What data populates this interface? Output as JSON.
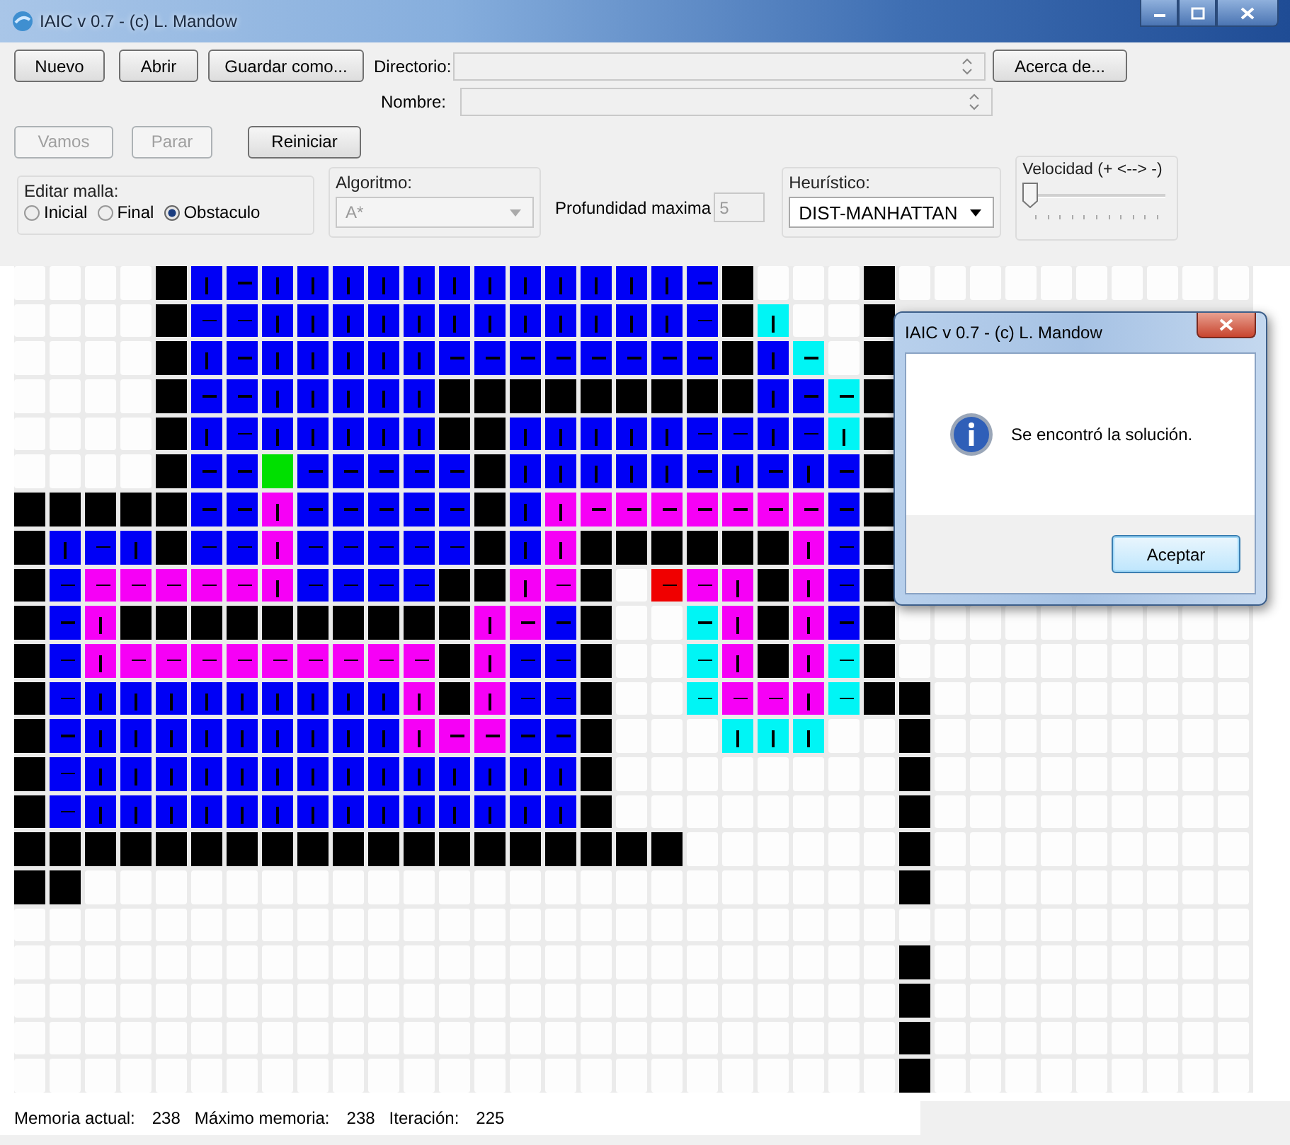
{
  "window": {
    "title": "IAIC v 0.7 - (c) L. Mandow"
  },
  "file_buttons": [
    {
      "label": "Nuevo"
    },
    {
      "label": "Abrir"
    },
    {
      "label": "Guardar como..."
    }
  ],
  "directory": {
    "label": "Directorio:"
  },
  "name": {
    "label": "Nombre:"
  },
  "about_button": {
    "label": "Acerca de..."
  },
  "run_buttons": [
    {
      "label": "Vamos",
      "disabled": true
    },
    {
      "label": "Parar",
      "disabled": true
    },
    {
      "label": "Reiniciar",
      "disabled": false
    }
  ],
  "edit_mode": {
    "label": "Editar malla:",
    "options": [
      {
        "label": "Inicial",
        "selected": false
      },
      {
        "label": "Final",
        "selected": false
      },
      {
        "label": "Obstaculo",
        "selected": true
      }
    ]
  },
  "algorithm": {
    "label": "Algoritmo:",
    "value": "A*",
    "disabled": true
  },
  "max_depth": {
    "label": "Profundidad maxima",
    "value": "5",
    "disabled": true
  },
  "heuristic": {
    "label": "Heurístico:",
    "value": "DIST-MANHATTAN"
  },
  "speed": {
    "label": "Velocidad (+ <--> -)",
    "level": 0
  },
  "grid": {
    "rows": [
      [
        {
          "kind": "E"
        },
        {
          "kind": "E"
        },
        {
          "kind": "E"
        },
        {
          "kind": "E"
        },
        {
          "kind": "W"
        },
        {
          "kind": "Bv"
        },
        {
          "kind": "Bh"
        },
        {
          "kind": "Bv"
        },
        {
          "kind": "Bv"
        },
        {
          "kind": "Bv"
        },
        {
          "kind": "Bv"
        },
        {
          "kind": "Bv"
        },
        {
          "kind": "Bv"
        },
        {
          "kind": "Bv"
        },
        {
          "kind": "Bv"
        },
        {
          "kind": "Bv"
        },
        {
          "kind": "Bv"
        },
        {
          "kind": "Bv"
        },
        {
          "kind": "Bv"
        },
        {
          "kind": "Bh"
        },
        {
          "kind": "W"
        },
        {
          "kind": "E"
        },
        {
          "kind": "E"
        },
        {
          "kind": "E"
        },
        {
          "kind": "W"
        },
        {
          "kind": "E"
        },
        {
          "kind": "E"
        },
        {
          "kind": "E"
        },
        {
          "kind": "E"
        },
        {
          "kind": "E"
        },
        {
          "kind": "E"
        },
        {
          "kind": "E"
        },
        {
          "kind": "E"
        },
        {
          "kind": "E"
        },
        {
          "kind": "E"
        }
      ],
      [
        {
          "kind": "E"
        },
        {
          "kind": "E"
        },
        {
          "kind": "E"
        },
        {
          "kind": "E"
        },
        {
          "kind": "W"
        },
        {
          "kind": "Bh"
        },
        {
          "kind": "Bh"
        },
        {
          "kind": "Bv"
        },
        {
          "kind": "Bv"
        },
        {
          "kind": "Bv"
        },
        {
          "kind": "Bv"
        },
        {
          "kind": "Bv"
        },
        {
          "kind": "Bv"
        },
        {
          "kind": "Bv"
        },
        {
          "kind": "Bv"
        },
        {
          "kind": "Bv"
        },
        {
          "kind": "Bv"
        },
        {
          "kind": "Bv"
        },
        {
          "kind": "Bv"
        },
        {
          "kind": "Bh"
        },
        {
          "kind": "W"
        },
        {
          "kind": "Cv"
        },
        {
          "kind": "E"
        },
        {
          "kind": "E"
        },
        {
          "kind": "W"
        }
      ],
      [
        {
          "kind": "E"
        },
        {
          "kind": "E"
        },
        {
          "kind": "E"
        },
        {
          "kind": "E"
        },
        {
          "kind": "W"
        },
        {
          "kind": "Bv"
        },
        {
          "kind": "Bh"
        },
        {
          "kind": "Bv"
        },
        {
          "kind": "Bv"
        },
        {
          "kind": "Bv"
        },
        {
          "kind": "Bv"
        },
        {
          "kind": "Bv"
        },
        {
          "kind": "Bh"
        },
        {
          "kind": "Bh"
        },
        {
          "kind": "Bh"
        },
        {
          "kind": "Bh"
        },
        {
          "kind": "Bh"
        },
        {
          "kind": "Bh"
        },
        {
          "kind": "Bh"
        },
        {
          "kind": "Bh"
        },
        {
          "kind": "W"
        },
        {
          "kind": "Bv"
        },
        {
          "kind": "Ch"
        },
        {
          "kind": "E"
        },
        {
          "kind": "W"
        }
      ],
      [
        {
          "kind": "E"
        },
        {
          "kind": "E"
        },
        {
          "kind": "E"
        },
        {
          "kind": "E"
        },
        {
          "kind": "W"
        },
        {
          "kind": "Bh"
        },
        {
          "kind": "Bh"
        },
        {
          "kind": "Bv"
        },
        {
          "kind": "Bv"
        },
        {
          "kind": "Bv"
        },
        {
          "kind": "Bv"
        },
        {
          "kind": "Bv"
        },
        {
          "kind": "W"
        },
        {
          "kind": "W"
        },
        {
          "kind": "W"
        },
        {
          "kind": "W"
        },
        {
          "kind": "W"
        },
        {
          "kind": "W"
        },
        {
          "kind": "W"
        },
        {
          "kind": "W"
        },
        {
          "kind": "W"
        },
        {
          "kind": "Bv"
        },
        {
          "kind": "Bh"
        },
        {
          "kind": "Ch"
        },
        {
          "kind": "W"
        }
      ],
      [
        {
          "kind": "E"
        },
        {
          "kind": "E"
        },
        {
          "kind": "E"
        },
        {
          "kind": "E"
        },
        {
          "kind": "W"
        },
        {
          "kind": "Bv"
        },
        {
          "kind": "Bh"
        },
        {
          "kind": "Bv"
        },
        {
          "kind": "Bv"
        },
        {
          "kind": "Bv"
        },
        {
          "kind": "Bv"
        },
        {
          "kind": "Bv"
        },
        {
          "kind": "W"
        },
        {
          "kind": "W"
        },
        {
          "kind": "Bv"
        },
        {
          "kind": "Bv"
        },
        {
          "kind": "Bv"
        },
        {
          "kind": "Bv"
        },
        {
          "kind": "Bv"
        },
        {
          "kind": "Bh"
        },
        {
          "kind": "Bh"
        },
        {
          "kind": "Bv"
        },
        {
          "kind": "Bh"
        },
        {
          "kind": "Cv"
        },
        {
          "kind": "W"
        }
      ],
      [
        {
          "kind": "E"
        },
        {
          "kind": "E"
        },
        {
          "kind": "E"
        },
        {
          "kind": "E"
        },
        {
          "kind": "W"
        },
        {
          "kind": "Bh"
        },
        {
          "kind": "Bh"
        },
        {
          "kind": "S"
        },
        {
          "kind": "Bh"
        },
        {
          "kind": "Bh"
        },
        {
          "kind": "Bh"
        },
        {
          "kind": "Bh"
        },
        {
          "kind": "Bh"
        },
        {
          "kind": "W"
        },
        {
          "kind": "Bv"
        },
        {
          "kind": "Bv"
        },
        {
          "kind": "Bv"
        },
        {
          "kind": "Bv"
        },
        {
          "kind": "Bv"
        },
        {
          "kind": "Bh"
        },
        {
          "kind": "Bv"
        },
        {
          "kind": "Bh"
        },
        {
          "kind": "Bv"
        },
        {
          "kind": "Bh"
        },
        {
          "kind": "W"
        }
      ],
      [
        {
          "kind": "W"
        },
        {
          "kind": "W"
        },
        {
          "kind": "W"
        },
        {
          "kind": "W"
        },
        {
          "kind": "W"
        },
        {
          "kind": "Bh"
        },
        {
          "kind": "Bh"
        },
        {
          "kind": "Pv"
        },
        {
          "kind": "Bh"
        },
        {
          "kind": "Bh"
        },
        {
          "kind": "Bh"
        },
        {
          "kind": "Bh"
        },
        {
          "kind": "Bh"
        },
        {
          "kind": "W"
        },
        {
          "kind": "Bv"
        },
        {
          "kind": "Pv"
        },
        {
          "kind": "Ph"
        },
        {
          "kind": "Ph"
        },
        {
          "kind": "Ph"
        },
        {
          "kind": "Ph"
        },
        {
          "kind": "Ph"
        },
        {
          "kind": "Ph"
        },
        {
          "kind": "Ph"
        },
        {
          "kind": "Bh"
        },
        {
          "kind": "W"
        }
      ],
      [
        {
          "kind": "W"
        },
        {
          "kind": "Bv"
        },
        {
          "kind": "Bh"
        },
        {
          "kind": "Bv"
        },
        {
          "kind": "W"
        },
        {
          "kind": "Bh"
        },
        {
          "kind": "Bh"
        },
        {
          "kind": "Pv"
        },
        {
          "kind": "Bh"
        },
        {
          "kind": "Bh"
        },
        {
          "kind": "Bh"
        },
        {
          "kind": "Bh"
        },
        {
          "kind": "Bh"
        },
        {
          "kind": "W"
        },
        {
          "kind": "Bv"
        },
        {
          "kind": "Pv"
        },
        {
          "kind": "W"
        },
        {
          "kind": "W"
        },
        {
          "kind": "W"
        },
        {
          "kind": "W"
        },
        {
          "kind": "W"
        },
        {
          "kind": "W"
        },
        {
          "kind": "Pv"
        },
        {
          "kind": "Bh"
        },
        {
          "kind": "W"
        }
      ],
      [
        {
          "kind": "W"
        },
        {
          "kind": "Bh"
        },
        {
          "kind": "Ph"
        },
        {
          "kind": "Ph"
        },
        {
          "kind": "Ph"
        },
        {
          "kind": "Ph"
        },
        {
          "kind": "Ph"
        },
        {
          "kind": "Pv"
        },
        {
          "kind": "Bh"
        },
        {
          "kind": "Bh"
        },
        {
          "kind": "Bh"
        },
        {
          "kind": "Bh"
        },
        {
          "kind": "W"
        },
        {
          "kind": "W"
        },
        {
          "kind": "Pv"
        },
        {
          "kind": "Ph"
        },
        {
          "kind": "W"
        },
        {
          "kind": "E"
        },
        {
          "kind": "Gh"
        },
        {
          "kind": "Ph"
        },
        {
          "kind": "Pv"
        },
        {
          "kind": "W"
        },
        {
          "kind": "Pv"
        },
        {
          "kind": "Bh"
        },
        {
          "kind": "W"
        }
      ],
      [
        {
          "kind": "W"
        },
        {
          "kind": "Bh"
        },
        {
          "kind": "Pv"
        },
        {
          "kind": "W"
        },
        {
          "kind": "W"
        },
        {
          "kind": "W"
        },
        {
          "kind": "W"
        },
        {
          "kind": "W"
        },
        {
          "kind": "W"
        },
        {
          "kind": "W"
        },
        {
          "kind": "W"
        },
        {
          "kind": "W"
        },
        {
          "kind": "W"
        },
        {
          "kind": "Pv"
        },
        {
          "kind": "Ph"
        },
        {
          "kind": "Bh"
        },
        {
          "kind": "W"
        },
        {
          "kind": "E"
        },
        {
          "kind": "E"
        },
        {
          "kind": "Ch"
        },
        {
          "kind": "Pv"
        },
        {
          "kind": "W"
        },
        {
          "kind": "Pv"
        },
        {
          "kind": "Bh"
        },
        {
          "kind": "W"
        },
        {
          "kind": "E"
        },
        {
          "kind": "E"
        },
        {
          "kind": "E"
        },
        {
          "kind": "E"
        },
        {
          "kind": "E"
        },
        {
          "kind": "E"
        },
        {
          "kind": "E"
        },
        {
          "kind": "E"
        },
        {
          "kind": "E"
        },
        {
          "kind": "E"
        }
      ],
      [
        {
          "kind": "W"
        },
        {
          "kind": "Bh"
        },
        {
          "kind": "Pv"
        },
        {
          "kind": "Ph"
        },
        {
          "kind": "Ph"
        },
        {
          "kind": "Ph"
        },
        {
          "kind": "Ph"
        },
        {
          "kind": "Ph"
        },
        {
          "kind": "Ph"
        },
        {
          "kind": "Ph"
        },
        {
          "kind": "Ph"
        },
        {
          "kind": "Ph"
        },
        {
          "kind": "W"
        },
        {
          "kind": "Pv"
        },
        {
          "kind": "Bh"
        },
        {
          "kind": "Bh"
        },
        {
          "kind": "W"
        },
        {
          "kind": "E"
        },
        {
          "kind": "E"
        },
        {
          "kind": "Ch"
        },
        {
          "kind": "Pv"
        },
        {
          "kind": "W"
        },
        {
          "kind": "Pv"
        },
        {
          "kind": "Ch"
        },
        {
          "kind": "W"
        },
        {
          "kind": "E"
        },
        {
          "kind": "E"
        },
        {
          "kind": "E"
        },
        {
          "kind": "E"
        },
        {
          "kind": "E"
        },
        {
          "kind": "E"
        },
        {
          "kind": "E"
        },
        {
          "kind": "E"
        },
        {
          "kind": "E"
        },
        {
          "kind": "E"
        }
      ],
      [
        {
          "kind": "W"
        },
        {
          "kind": "Bh"
        },
        {
          "kind": "Bv"
        },
        {
          "kind": "Bv"
        },
        {
          "kind": "Bv"
        },
        {
          "kind": "Bv"
        },
        {
          "kind": "Bv"
        },
        {
          "kind": "Bv"
        },
        {
          "kind": "Bv"
        },
        {
          "kind": "Bv"
        },
        {
          "kind": "Bv"
        },
        {
          "kind": "Pv"
        },
        {
          "kind": "W"
        },
        {
          "kind": "Pv"
        },
        {
          "kind": "Bh"
        },
        {
          "kind": "Bh"
        },
        {
          "kind": "W"
        },
        {
          "kind": "E"
        },
        {
          "kind": "E"
        },
        {
          "kind": "Ch"
        },
        {
          "kind": "Ph"
        },
        {
          "kind": "Ph"
        },
        {
          "kind": "Pv"
        },
        {
          "kind": "Ch"
        },
        {
          "kind": "W"
        },
        {
          "kind": "W"
        },
        {
          "kind": "E"
        },
        {
          "kind": "E"
        },
        {
          "kind": "E"
        },
        {
          "kind": "E"
        },
        {
          "kind": "E"
        },
        {
          "kind": "E"
        },
        {
          "kind": "E"
        },
        {
          "kind": "E"
        },
        {
          "kind": "E"
        }
      ],
      [
        {
          "kind": "W"
        },
        {
          "kind": "Bh"
        },
        {
          "kind": "Bv"
        },
        {
          "kind": "Bv"
        },
        {
          "kind": "Bv"
        },
        {
          "kind": "Bv"
        },
        {
          "kind": "Bv"
        },
        {
          "kind": "Bv"
        },
        {
          "kind": "Bv"
        },
        {
          "kind": "Bv"
        },
        {
          "kind": "Bv"
        },
        {
          "kind": "Pv"
        },
        {
          "kind": "Ph"
        },
        {
          "kind": "Ph"
        },
        {
          "kind": "Bh"
        },
        {
          "kind": "Bh"
        },
        {
          "kind": "W"
        },
        {
          "kind": "E"
        },
        {
          "kind": "E"
        },
        {
          "kind": "E"
        },
        {
          "kind": "Cv"
        },
        {
          "kind": "Cv"
        },
        {
          "kind": "Cv"
        },
        {
          "kind": "E"
        },
        {
          "kind": "E"
        },
        {
          "kind": "W"
        },
        {
          "kind": "E"
        },
        {
          "kind": "E"
        },
        {
          "kind": "E"
        },
        {
          "kind": "E"
        },
        {
          "kind": "E"
        },
        {
          "kind": "E"
        },
        {
          "kind": "E"
        },
        {
          "kind": "E"
        },
        {
          "kind": "E"
        }
      ],
      [
        {
          "kind": "W"
        },
        {
          "kind": "Bh"
        },
        {
          "kind": "Bv"
        },
        {
          "kind": "Bv"
        },
        {
          "kind": "Bv"
        },
        {
          "kind": "Bv"
        },
        {
          "kind": "Bv"
        },
        {
          "kind": "Bv"
        },
        {
          "kind": "Bv"
        },
        {
          "kind": "Bv"
        },
        {
          "kind": "Bv"
        },
        {
          "kind": "Bv"
        },
        {
          "kind": "Bv"
        },
        {
          "kind": "Bv"
        },
        {
          "kind": "Bv"
        },
        {
          "kind": "Bv"
        },
        {
          "kind": "W"
        },
        {
          "kind": "E"
        },
        {
          "kind": "E"
        },
        {
          "kind": "E"
        },
        {
          "kind": "E"
        },
        {
          "kind": "E"
        },
        {
          "kind": "E"
        },
        {
          "kind": "E"
        },
        {
          "kind": "E"
        },
        {
          "kind": "W"
        },
        {
          "kind": "E"
        },
        {
          "kind": "E"
        },
        {
          "kind": "E"
        },
        {
          "kind": "E"
        },
        {
          "kind": "E"
        },
        {
          "kind": "E"
        },
        {
          "kind": "E"
        },
        {
          "kind": "E"
        },
        {
          "kind": "E"
        }
      ],
      [
        {
          "kind": "W"
        },
        {
          "kind": "Bh"
        },
        {
          "kind": "Bv"
        },
        {
          "kind": "Bv"
        },
        {
          "kind": "Bv"
        },
        {
          "kind": "Bv"
        },
        {
          "kind": "Bv"
        },
        {
          "kind": "Bv"
        },
        {
          "kind": "Bv"
        },
        {
          "kind": "Bv"
        },
        {
          "kind": "Bv"
        },
        {
          "kind": "Bv"
        },
        {
          "kind": "Bv"
        },
        {
          "kind": "Bv"
        },
        {
          "kind": "Bv"
        },
        {
          "kind": "Bv"
        },
        {
          "kind": "W"
        },
        {
          "kind": "E"
        },
        {
          "kind": "E"
        },
        {
          "kind": "E"
        },
        {
          "kind": "E"
        },
        {
          "kind": "E"
        },
        {
          "kind": "E"
        },
        {
          "kind": "E"
        },
        {
          "kind": "E"
        },
        {
          "kind": "W"
        },
        {
          "kind": "E"
        },
        {
          "kind": "E"
        },
        {
          "kind": "E"
        },
        {
          "kind": "E"
        },
        {
          "kind": "E"
        },
        {
          "kind": "E"
        },
        {
          "kind": "E"
        },
        {
          "kind": "E"
        },
        {
          "kind": "E"
        }
      ],
      [
        {
          "kind": "W"
        },
        {
          "kind": "W"
        },
        {
          "kind": "W"
        },
        {
          "kind": "W"
        },
        {
          "kind": "W"
        },
        {
          "kind": "W"
        },
        {
          "kind": "W"
        },
        {
          "kind": "W"
        },
        {
          "kind": "W"
        },
        {
          "kind": "W"
        },
        {
          "kind": "W"
        },
        {
          "kind": "W"
        },
        {
          "kind": "W"
        },
        {
          "kind": "W"
        },
        {
          "kind": "W"
        },
        {
          "kind": "W"
        },
        {
          "kind": "W"
        },
        {
          "kind": "W"
        },
        {
          "kind": "W"
        },
        {
          "kind": "E"
        },
        {
          "kind": "E"
        },
        {
          "kind": "E"
        },
        {
          "kind": "E"
        },
        {
          "kind": "E"
        },
        {
          "kind": "E"
        },
        {
          "kind": "W"
        },
        {
          "kind": "E"
        },
        {
          "kind": "E"
        },
        {
          "kind": "E"
        },
        {
          "kind": "E"
        },
        {
          "kind": "E"
        },
        {
          "kind": "E"
        },
        {
          "kind": "E"
        },
        {
          "kind": "E"
        },
        {
          "kind": "E"
        }
      ],
      [
        {
          "kind": "W"
        },
        {
          "kind": "W"
        },
        {
          "kind": "E"
        },
        {
          "kind": "E"
        },
        {
          "kind": "E"
        },
        {
          "kind": "E"
        },
        {
          "kind": "E"
        },
        {
          "kind": "E"
        },
        {
          "kind": "E"
        },
        {
          "kind": "E"
        },
        {
          "kind": "E"
        },
        {
          "kind": "E"
        },
        {
          "kind": "E"
        },
        {
          "kind": "E"
        },
        {
          "kind": "E"
        },
        {
          "kind": "E"
        },
        {
          "kind": "E"
        },
        {
          "kind": "E"
        },
        {
          "kind": "E"
        },
        {
          "kind": "E"
        },
        {
          "kind": "E"
        },
        {
          "kind": "E"
        },
        {
          "kind": "E"
        },
        {
          "kind": "E"
        },
        {
          "kind": "E"
        },
        {
          "kind": "W"
        },
        {
          "kind": "E"
        },
        {
          "kind": "E"
        },
        {
          "kind": "E"
        },
        {
          "kind": "E"
        },
        {
          "kind": "E"
        },
        {
          "kind": "E"
        },
        {
          "kind": "E"
        },
        {
          "kind": "E"
        },
        {
          "kind": "E"
        }
      ],
      [
        {
          "kind": "E"
        },
        {
          "kind": "E"
        },
        {
          "kind": "E"
        },
        {
          "kind": "E"
        },
        {
          "kind": "E"
        },
        {
          "kind": "E"
        },
        {
          "kind": "E"
        },
        {
          "kind": "E"
        },
        {
          "kind": "E"
        },
        {
          "kind": "E"
        },
        {
          "kind": "E"
        },
        {
          "kind": "E"
        },
        {
          "kind": "E"
        },
        {
          "kind": "E"
        },
        {
          "kind": "E"
        },
        {
          "kind": "E"
        },
        {
          "kind": "E"
        },
        {
          "kind": "E"
        },
        {
          "kind": "E"
        },
        {
          "kind": "E"
        },
        {
          "kind": "E"
        },
        {
          "kind": "E"
        },
        {
          "kind": "E"
        },
        {
          "kind": "E"
        },
        {
          "kind": "E"
        },
        {
          "kind": "E"
        },
        {
          "kind": "E"
        },
        {
          "kind": "E"
        },
        {
          "kind": "E"
        },
        {
          "kind": "E"
        },
        {
          "kind": "E"
        },
        {
          "kind": "E"
        },
        {
          "kind": "E"
        },
        {
          "kind": "E"
        },
        {
          "kind": "E"
        }
      ],
      [
        {
          "kind": "E"
        },
        {
          "kind": "E"
        },
        {
          "kind": "E"
        },
        {
          "kind": "E"
        },
        {
          "kind": "E"
        },
        {
          "kind": "E"
        },
        {
          "kind": "E"
        },
        {
          "kind": "E"
        },
        {
          "kind": "E"
        },
        {
          "kind": "E"
        },
        {
          "kind": "E"
        },
        {
          "kind": "E"
        },
        {
          "kind": "E"
        },
        {
          "kind": "E"
        },
        {
          "kind": "E"
        },
        {
          "kind": "E"
        },
        {
          "kind": "E"
        },
        {
          "kind": "E"
        },
        {
          "kind": "E"
        },
        {
          "kind": "E"
        },
        {
          "kind": "E"
        },
        {
          "kind": "E"
        },
        {
          "kind": "E"
        },
        {
          "kind": "E"
        },
        {
          "kind": "E"
        },
        {
          "kind": "W"
        },
        {
          "kind": "E"
        },
        {
          "kind": "E"
        },
        {
          "kind": "E"
        },
        {
          "kind": "E"
        },
        {
          "kind": "E"
        },
        {
          "kind": "E"
        },
        {
          "kind": "E"
        },
        {
          "kind": "E"
        },
        {
          "kind": "E"
        }
      ],
      [
        {
          "kind": "E"
        },
        {
          "kind": "E"
        },
        {
          "kind": "E"
        },
        {
          "kind": "E"
        },
        {
          "kind": "E"
        },
        {
          "kind": "E"
        },
        {
          "kind": "E"
        },
        {
          "kind": "E"
        },
        {
          "kind": "E"
        },
        {
          "kind": "E"
        },
        {
          "kind": "E"
        },
        {
          "kind": "E"
        },
        {
          "kind": "E"
        },
        {
          "kind": "E"
        },
        {
          "kind": "E"
        },
        {
          "kind": "E"
        },
        {
          "kind": "E"
        },
        {
          "kind": "E"
        },
        {
          "kind": "E"
        },
        {
          "kind": "E"
        },
        {
          "kind": "E"
        },
        {
          "kind": "E"
        },
        {
          "kind": "E"
        },
        {
          "kind": "E"
        },
        {
          "kind": "E"
        },
        {
          "kind": "W"
        },
        {
          "kind": "E"
        },
        {
          "kind": "E"
        },
        {
          "kind": "E"
        },
        {
          "kind": "E"
        },
        {
          "kind": "E"
        },
        {
          "kind": "E"
        },
        {
          "kind": "E"
        },
        {
          "kind": "E"
        },
        {
          "kind": "E"
        }
      ],
      [
        {
          "kind": "E"
        },
        {
          "kind": "E"
        },
        {
          "kind": "E"
        },
        {
          "kind": "E"
        },
        {
          "kind": "E"
        },
        {
          "kind": "E"
        },
        {
          "kind": "E"
        },
        {
          "kind": "E"
        },
        {
          "kind": "E"
        },
        {
          "kind": "E"
        },
        {
          "kind": "E"
        },
        {
          "kind": "E"
        },
        {
          "kind": "E"
        },
        {
          "kind": "E"
        },
        {
          "kind": "E"
        },
        {
          "kind": "E"
        },
        {
          "kind": "E"
        },
        {
          "kind": "E"
        },
        {
          "kind": "E"
        },
        {
          "kind": "E"
        },
        {
          "kind": "E"
        },
        {
          "kind": "E"
        },
        {
          "kind": "E"
        },
        {
          "kind": "E"
        },
        {
          "kind": "E"
        },
        {
          "kind": "W"
        },
        {
          "kind": "E"
        },
        {
          "kind": "E"
        },
        {
          "kind": "E"
        },
        {
          "kind": "E"
        },
        {
          "kind": "E"
        },
        {
          "kind": "E"
        },
        {
          "kind": "E"
        },
        {
          "kind": "E"
        },
        {
          "kind": "E"
        }
      ],
      [
        {
          "kind": "E"
        },
        {
          "kind": "E"
        },
        {
          "kind": "E"
        },
        {
          "kind": "E"
        },
        {
          "kind": "E"
        },
        {
          "kind": "E"
        },
        {
          "kind": "E"
        },
        {
          "kind": "E"
        },
        {
          "kind": "E"
        },
        {
          "kind": "E"
        },
        {
          "kind": "E"
        },
        {
          "kind": "E"
        },
        {
          "kind": "E"
        },
        {
          "kind": "E"
        },
        {
          "kind": "E"
        },
        {
          "kind": "E"
        },
        {
          "kind": "E"
        },
        {
          "kind": "E"
        },
        {
          "kind": "E"
        },
        {
          "kind": "E"
        },
        {
          "kind": "E"
        },
        {
          "kind": "E"
        },
        {
          "kind": "E"
        },
        {
          "kind": "E"
        },
        {
          "kind": "E"
        },
        {
          "kind": "W"
        },
        {
          "kind": "E"
        },
        {
          "kind": "E"
        },
        {
          "kind": "E"
        },
        {
          "kind": "E"
        },
        {
          "kind": "E"
        },
        {
          "kind": "E"
        },
        {
          "kind": "E"
        },
        {
          "kind": "E"
        },
        {
          "kind": "E"
        }
      ]
    ]
  },
  "status_bar": [
    {
      "label": "Memoria actual:",
      "value": "238"
    },
    {
      "label": "Máximo memoria:",
      "value": "238"
    },
    {
      "label": "Iteración:",
      "value": "225"
    }
  ],
  "dialog": {
    "title": "IAIC v 0.7 - (c) L. Mandow",
    "message": "Se encontró la solución.",
    "button": "Aceptar"
  }
}
